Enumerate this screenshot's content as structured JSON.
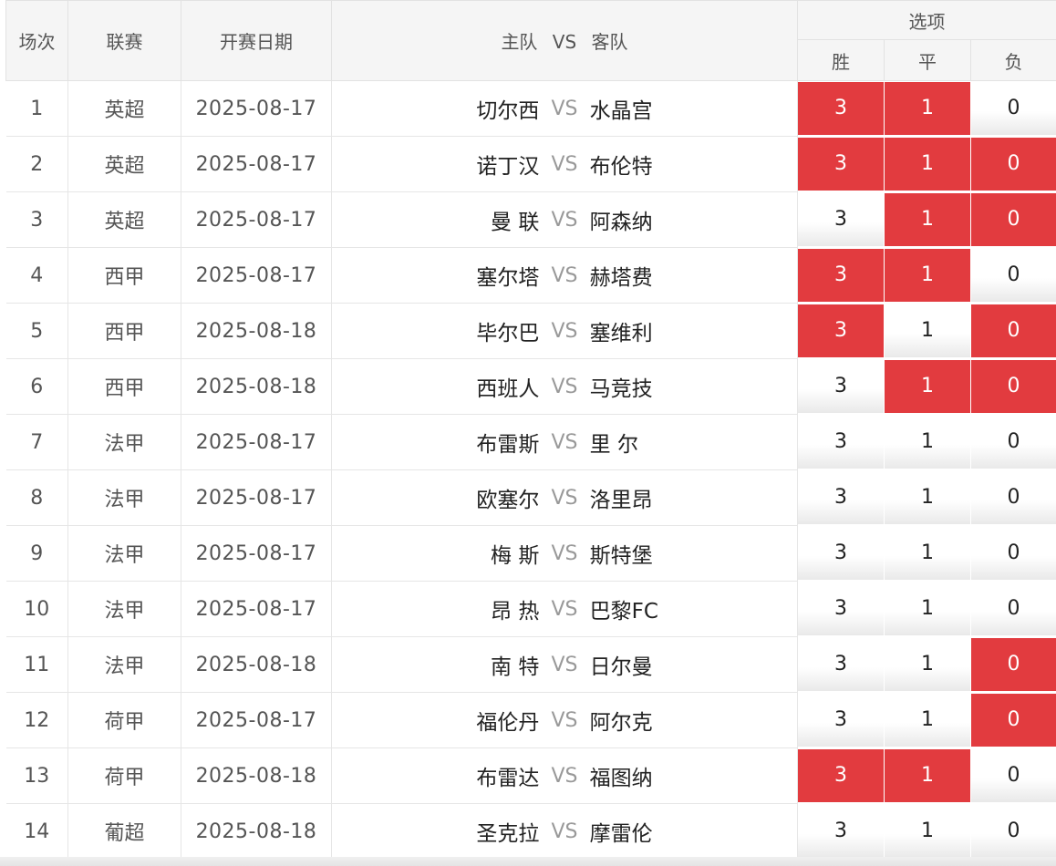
{
  "header": {
    "num": "场次",
    "league": "联赛",
    "date": "开赛日期",
    "home": "主队",
    "vs": "VS",
    "away": "客队",
    "options": "选项",
    "win": "胜",
    "draw": "平",
    "lose": "负"
  },
  "colors": {
    "selected": "#e23b3f",
    "header_bg": "#f5f5f5"
  },
  "rows": [
    {
      "num": "1",
      "league": "英超",
      "date": "2025-08-17",
      "home": "切尔西",
      "away": "水晶宫",
      "win": "3",
      "draw": "1",
      "lose": "0",
      "sel": [
        true,
        true,
        false
      ]
    },
    {
      "num": "2",
      "league": "英超",
      "date": "2025-08-17",
      "home": "诺丁汉",
      "away": "布伦特",
      "win": "3",
      "draw": "1",
      "lose": "0",
      "sel": [
        true,
        true,
        true
      ]
    },
    {
      "num": "3",
      "league": "英超",
      "date": "2025-08-17",
      "home": "曼 联",
      "away": "阿森纳",
      "win": "3",
      "draw": "1",
      "lose": "0",
      "sel": [
        false,
        true,
        true
      ]
    },
    {
      "num": "4",
      "league": "西甲",
      "date": "2025-08-17",
      "home": "塞尔塔",
      "away": "赫塔费",
      "win": "3",
      "draw": "1",
      "lose": "0",
      "sel": [
        true,
        true,
        false
      ]
    },
    {
      "num": "5",
      "league": "西甲",
      "date": "2025-08-18",
      "home": "毕尔巴",
      "away": "塞维利",
      "win": "3",
      "draw": "1",
      "lose": "0",
      "sel": [
        true,
        false,
        true
      ]
    },
    {
      "num": "6",
      "league": "西甲",
      "date": "2025-08-18",
      "home": "西班人",
      "away": "马竞技",
      "win": "3",
      "draw": "1",
      "lose": "0",
      "sel": [
        false,
        true,
        true
      ]
    },
    {
      "num": "7",
      "league": "法甲",
      "date": "2025-08-17",
      "home": "布雷斯",
      "away": "里 尔",
      "win": "3",
      "draw": "1",
      "lose": "0",
      "sel": [
        false,
        false,
        false
      ]
    },
    {
      "num": "8",
      "league": "法甲",
      "date": "2025-08-17",
      "home": "欧塞尔",
      "away": "洛里昂",
      "win": "3",
      "draw": "1",
      "lose": "0",
      "sel": [
        false,
        false,
        false
      ]
    },
    {
      "num": "9",
      "league": "法甲",
      "date": "2025-08-17",
      "home": "梅 斯",
      "away": "斯特堡",
      "win": "3",
      "draw": "1",
      "lose": "0",
      "sel": [
        false,
        false,
        false
      ]
    },
    {
      "num": "10",
      "league": "法甲",
      "date": "2025-08-17",
      "home": "昂 热",
      "away": "巴黎FC",
      "win": "3",
      "draw": "1",
      "lose": "0",
      "sel": [
        false,
        false,
        false
      ]
    },
    {
      "num": "11",
      "league": "法甲",
      "date": "2025-08-18",
      "home": "南 特",
      "away": "日尔曼",
      "win": "3",
      "draw": "1",
      "lose": "0",
      "sel": [
        false,
        false,
        true
      ]
    },
    {
      "num": "12",
      "league": "荷甲",
      "date": "2025-08-17",
      "home": "福伦丹",
      "away": "阿尔克",
      "win": "3",
      "draw": "1",
      "lose": "0",
      "sel": [
        false,
        false,
        true
      ]
    },
    {
      "num": "13",
      "league": "荷甲",
      "date": "2025-08-18",
      "home": "布雷达",
      "away": "福图纳",
      "win": "3",
      "draw": "1",
      "lose": "0",
      "sel": [
        true,
        true,
        false
      ]
    },
    {
      "num": "14",
      "league": "葡超",
      "date": "2025-08-18",
      "home": "圣克拉",
      "away": "摩雷伦",
      "win": "3",
      "draw": "1",
      "lose": "0",
      "sel": [
        false,
        false,
        false
      ]
    }
  ]
}
